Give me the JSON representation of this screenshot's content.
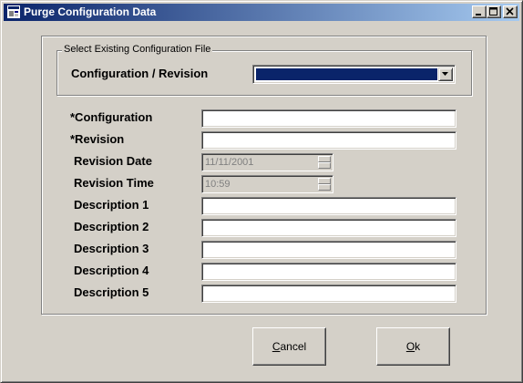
{
  "window": {
    "title": "Purge Configuration Data"
  },
  "group": {
    "legend": "Select Existing Configuration File",
    "label": "Configuration / Revision",
    "selected_value": ""
  },
  "fields": {
    "configuration": {
      "label": "*Configuration",
      "value": ""
    },
    "revision": {
      "label": "*Revision",
      "value": ""
    },
    "revision_date": {
      "label": "Revision Date",
      "value": "11/11/2001"
    },
    "revision_time": {
      "label": "Revision Time",
      "value": "10:59"
    },
    "description1": {
      "label": "Description 1",
      "value": ""
    },
    "description2": {
      "label": "Description 2",
      "value": ""
    },
    "description3": {
      "label": "Description 3",
      "value": ""
    },
    "description4": {
      "label": "Description 4",
      "value": ""
    },
    "description5": {
      "label": "Description 5",
      "value": ""
    }
  },
  "buttons": {
    "cancel": {
      "mnemonic": "C",
      "rest": "ancel"
    },
    "ok": {
      "mnemonic": "O",
      "rest": "k"
    }
  },
  "colors": {
    "titlebar_start": "#0a246a",
    "titlebar_end": "#a6caf0",
    "face": "#d4d0c8",
    "selection": "#0a246a"
  },
  "icons": [
    "app-icon",
    "minimize-icon",
    "maximize-icon",
    "close-icon",
    "dropdown-arrow-icon"
  ]
}
